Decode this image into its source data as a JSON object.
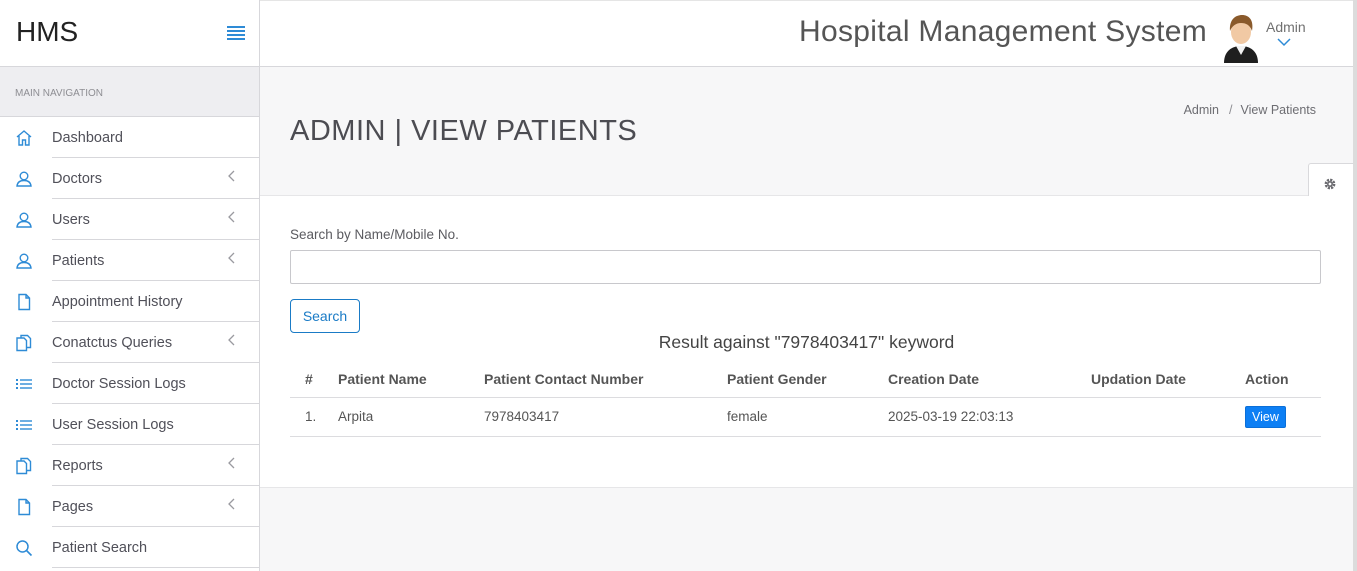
{
  "brand": {
    "name": "HMS"
  },
  "sidebar": {
    "header": "MAIN NAVIGATION",
    "items": [
      {
        "label": "Dashboard",
        "icon": "home-icon",
        "has_submenu": false
      },
      {
        "label": "Doctors",
        "icon": "user-icon",
        "has_submenu": true
      },
      {
        "label": "Users",
        "icon": "user-icon",
        "has_submenu": true
      },
      {
        "label": "Patients",
        "icon": "user-icon",
        "has_submenu": true
      },
      {
        "label": "Appointment History",
        "icon": "file-icon",
        "has_submenu": false
      },
      {
        "label": "Conatctus Queries",
        "icon": "files-icon",
        "has_submenu": true
      },
      {
        "label": "Doctor Session Logs",
        "icon": "list-icon",
        "has_submenu": false
      },
      {
        "label": "User Session Logs",
        "icon": "list-icon",
        "has_submenu": false
      },
      {
        "label": "Reports",
        "icon": "files-icon",
        "has_submenu": true
      },
      {
        "label": "Pages",
        "icon": "file-icon",
        "has_submenu": true
      },
      {
        "label": "Patient Search",
        "icon": "search-icon",
        "has_submenu": false
      }
    ]
  },
  "topbar": {
    "title": "Hospital Management System",
    "user": "Admin"
  },
  "page": {
    "title": "ADMIN | VIEW PATIENTS",
    "breadcrumb": [
      "Admin",
      "View Patients"
    ]
  },
  "search": {
    "label": "Search by Name/Mobile No.",
    "value": "",
    "button": "Search",
    "result_heading": "Result against \"7978403417\" keyword"
  },
  "table": {
    "columns": [
      "#",
      "Patient Name",
      "Patient Contact Number",
      "Patient Gender",
      "Creation Date",
      "Updation Date",
      "Action"
    ],
    "rows": [
      {
        "index": "1.",
        "name": "Arpita",
        "contact": "7978403417",
        "gender": "female",
        "created": "2025-03-19 22:03:13",
        "updated": "",
        "action": "View"
      }
    ]
  },
  "colors": {
    "accent": "#2e8bd6",
    "view_button": "#0d7ff4"
  }
}
